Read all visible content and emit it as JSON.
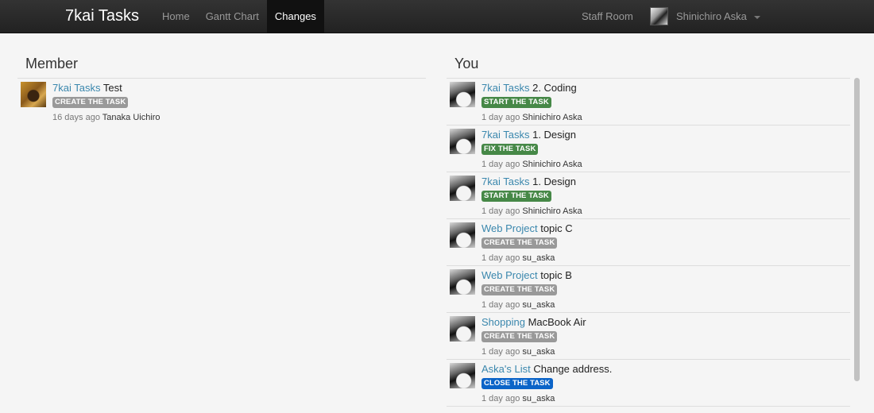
{
  "navbar": {
    "brand": "7kai Tasks",
    "items": [
      {
        "label": "Home"
      },
      {
        "label": "Gantt Chart"
      },
      {
        "label": "Changes",
        "active": true
      }
    ],
    "staff_room": "Staff Room",
    "user_name": "Shinichiro Aska"
  },
  "member": {
    "heading": "Member",
    "entries": [
      {
        "project": "7kai Tasks",
        "task": "Test",
        "action": "CREATE THE TASK",
        "ago": "16 days ago",
        "who": "Tanaka Uichiro"
      }
    ]
  },
  "you": {
    "heading": "You",
    "entries": [
      {
        "project": "7kai Tasks",
        "task": "2. Coding",
        "action": "START THE TASK",
        "ago": "1 day ago",
        "who": "Shinichiro Aska"
      },
      {
        "project": "7kai Tasks",
        "task": "1. Design",
        "action": "FIX THE TASK",
        "ago": "1 day ago",
        "who": "Shinichiro Aska"
      },
      {
        "project": "7kai Tasks",
        "task": "1. Design",
        "action": "START THE TASK",
        "ago": "1 day ago",
        "who": "Shinichiro Aska"
      },
      {
        "project": "Web Project",
        "task": "topic C",
        "action": "CREATE THE TASK",
        "ago": "1 day ago",
        "who": "su_aska"
      },
      {
        "project": "Web Project",
        "task": "topic B",
        "action": "CREATE THE TASK",
        "ago": "1 day ago",
        "who": "su_aska"
      },
      {
        "project": "Shopping",
        "task": "MacBook Air",
        "action": "CREATE THE TASK",
        "ago": "1 day ago",
        "who": "su_aska"
      },
      {
        "project": "Aska's List",
        "task": "Change address.",
        "action": "CLOSE THE TASK",
        "ago": "1 day ago",
        "who": "su_aska"
      }
    ]
  },
  "colors": {
    "link": "#3a87ad",
    "badge_create": "#999999",
    "badge_start": "#468847",
    "badge_fix": "#468847",
    "badge_close": "#0b64c8",
    "navbar": "#222222"
  }
}
